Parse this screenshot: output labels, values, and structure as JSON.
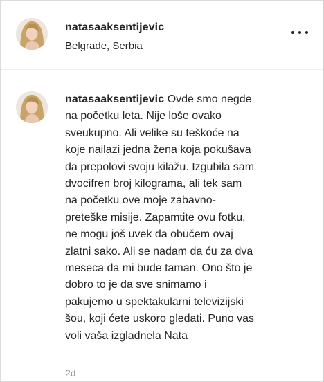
{
  "post": {
    "username": "natasaaksentijevic",
    "location": "Belgrade, Serbia"
  },
  "comment": {
    "username": "natasaaksentijevic",
    "lines": [
      "Ovde smo negde",
      "na početku leta. Nije loše ovako",
      "sveukupno. Ali velike su teškoće na",
      "koje nailazi jedna žena koja pokušava",
      "da prepolovi svoju kilažu. Izgubila sam",
      "dvocifren broj kilograma, ali tek sam",
      "na početku ove moje zabavno-",
      "preteške misije. Zapamtite ovu fotku,",
      "ne mogu još uvek da obučem ovaj",
      "zlatni sako. Ali se nadam da ću za dva",
      "meseca da mi bude taman. Ono što je",
      "dobro to je da sve snimamo i",
      "pakujemo u spektakularni televizijski",
      "šou, koji ćete uskoro gledati. Puno vas",
      "voli vaša izgladnela Nata"
    ],
    "time": "2d"
  },
  "icons": {
    "more": "more-options-icon"
  }
}
